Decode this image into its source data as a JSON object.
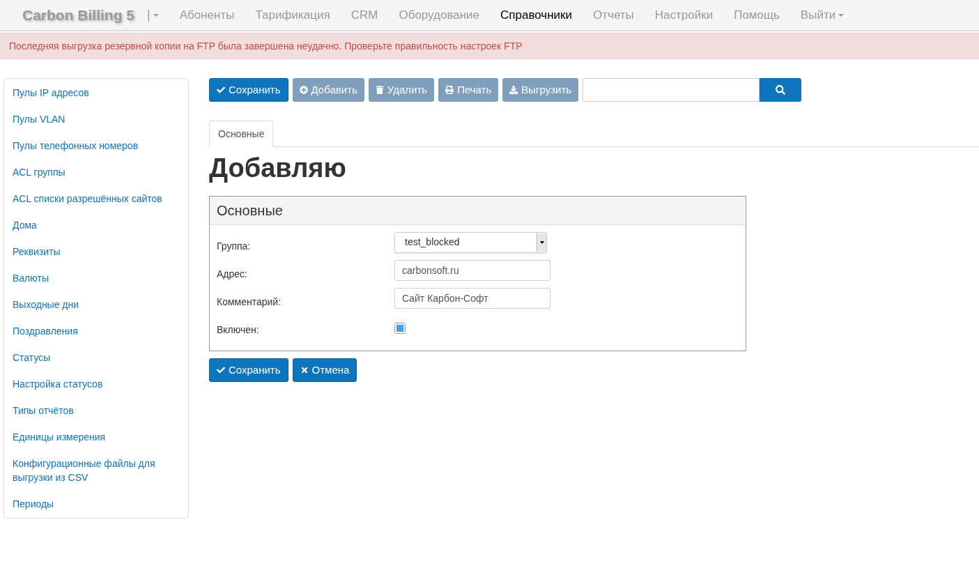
{
  "navbar": {
    "brand": "Carbon Billing 5",
    "brand_menu": "|",
    "items": [
      {
        "label": "Абоненты",
        "selected": false,
        "dropdown": false
      },
      {
        "label": "Тарификация",
        "selected": false,
        "dropdown": false
      },
      {
        "label": "CRM",
        "selected": false,
        "dropdown": false
      },
      {
        "label": "Оборудование",
        "selected": false,
        "dropdown": false
      },
      {
        "label": "Справочники",
        "selected": true,
        "dropdown": false
      },
      {
        "label": "Отчеты",
        "selected": false,
        "dropdown": false
      },
      {
        "label": "Настройки",
        "selected": false,
        "dropdown": false
      },
      {
        "label": "Помощь",
        "selected": false,
        "dropdown": false
      },
      {
        "label": "Выйти",
        "selected": false,
        "dropdown": true
      }
    ]
  },
  "alert": "Последняя выгрузка резервной копии на FTP была завершена неудачно. Проверьте правильность настроек FTP",
  "sidebar": {
    "items": [
      {
        "label": "Пулы IP адресов"
      },
      {
        "label": "Пулы VLAN"
      },
      {
        "label": "Пулы телефонных номеров"
      },
      {
        "label": "ACL группы"
      },
      {
        "label": "ACL списки разрешённых сайтов"
      },
      {
        "label": "Дома"
      },
      {
        "label": "Реквизиты"
      },
      {
        "label": "Валюты"
      },
      {
        "label": "Выходные дни"
      },
      {
        "label": "Поздравления"
      },
      {
        "label": "Статусы"
      },
      {
        "label": "Настройка статусов"
      },
      {
        "label": "Типы отчётов"
      },
      {
        "label": "Единицы измерения"
      },
      {
        "label": "Конфигурационные файлы для выгрузки из CSV"
      },
      {
        "label": "Периоды"
      }
    ]
  },
  "toolbar": {
    "buttons": [
      {
        "label": "Сохранить",
        "kind": "save",
        "disabled": false
      },
      {
        "label": "Добавить",
        "kind": "add",
        "disabled": true
      },
      {
        "label": "Удалить",
        "kind": "delete",
        "disabled": true
      },
      {
        "label": "Печать",
        "kind": "print",
        "disabled": true
      },
      {
        "label": "Выгрузить",
        "kind": "export",
        "disabled": true
      }
    ]
  },
  "tabs": [
    {
      "label": "Основные",
      "selected": true
    }
  ],
  "heading": "Добавляю",
  "panel": {
    "title": "Основные",
    "fields": [
      {
        "kind": "select",
        "label": "Группа:",
        "value": "test_blocked"
      },
      {
        "kind": "text",
        "label": "Адрес:",
        "value": "carbonsoft.ru"
      },
      {
        "kind": "text",
        "label": "Комментарий:",
        "value": "Сайт Карбон-Софт"
      },
      {
        "kind": "checkbox",
        "label": "Включен:",
        "checked": true
      }
    ]
  },
  "form_buttons": [
    {
      "label": "Сохранить",
      "kind": "save"
    },
    {
      "label": "Отмена",
      "kind": "cancel"
    }
  ]
}
